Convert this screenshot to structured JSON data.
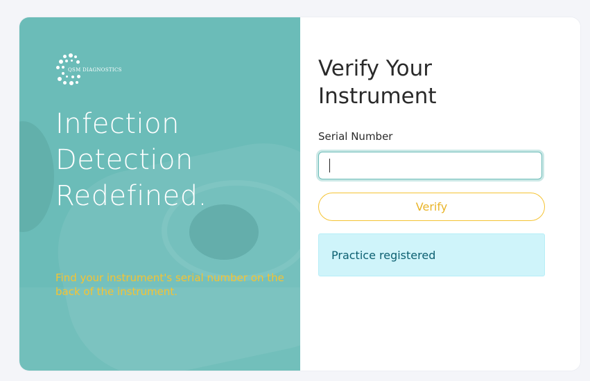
{
  "brand": {
    "name": "QSM DIAGNOSTICS",
    "logo_icon": "dot-cluster-logo-icon",
    "colors": {
      "teal": "#6bbcb8",
      "accent_yellow": "#f5c332",
      "alert_bg": "#cff4fa",
      "alert_text": "#0c6071"
    }
  },
  "hero": {
    "headline": "Infection Detection Redefined.",
    "hint": "Find your instrument's serial number on the back of the instrument."
  },
  "form": {
    "title": "Verify Your Instrument",
    "serial_label": "Serial Number",
    "serial_value": "",
    "serial_placeholder": "",
    "verify_label": "Verify"
  },
  "alert": {
    "message": "Practice registered"
  }
}
